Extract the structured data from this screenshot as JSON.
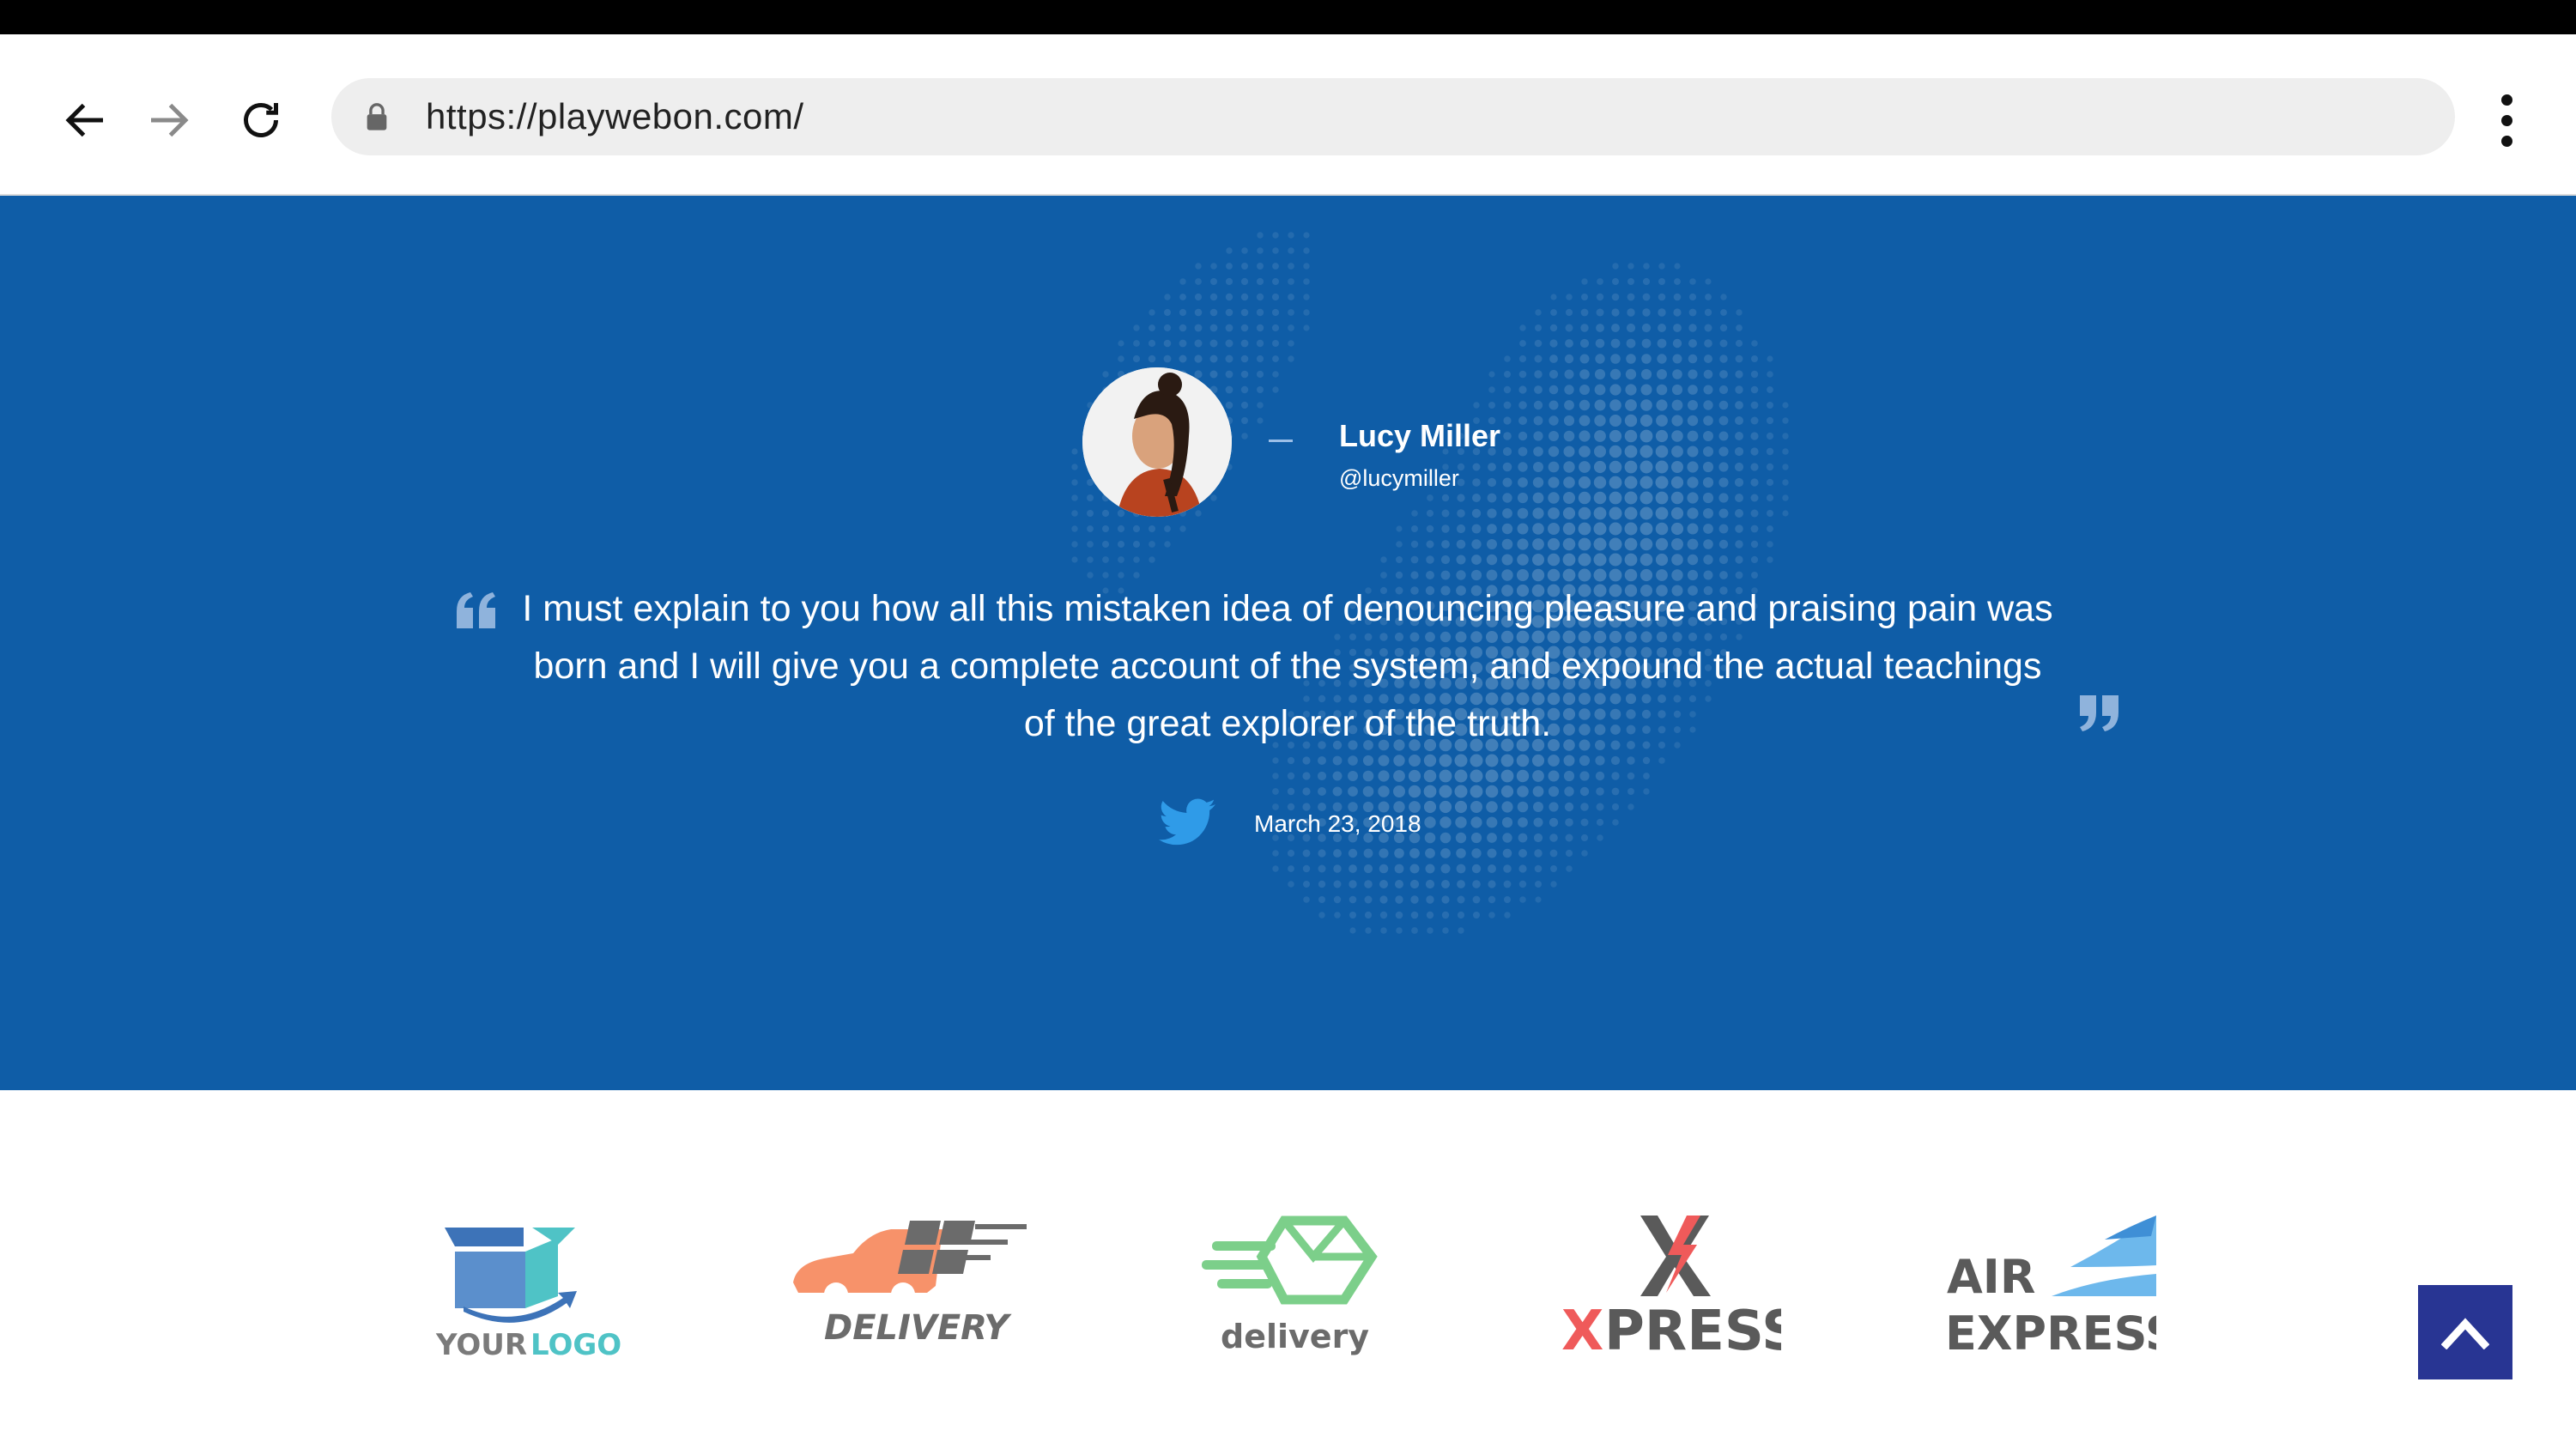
{
  "browser": {
    "url": "https://playwebon.com/",
    "back_icon": "arrow-left-icon",
    "forward_icon": "arrow-right-icon",
    "reload_icon": "reload-icon",
    "lock_icon": "lock-icon",
    "menu_icon": "more-vertical-icon"
  },
  "testimonial": {
    "author_name": "Lucy Miller",
    "author_handle": "@lucymiller",
    "quote": "I must explain to you how all this mistaken idea of denouncing pleasure and praising pain was born and I will give you a complete account of the system, and expound the actual teachings of the great explorer of the truth.",
    "source_icon": "twitter-icon",
    "date": "March 23, 2018"
  },
  "partners": {
    "logos": [
      {
        "line1": "YOUR",
        "line2": "LOGO"
      },
      {
        "line1": "DELIVERY"
      },
      {
        "line1": "delivery"
      },
      {
        "line1": "X",
        "line2": "PRESS"
      },
      {
        "line1": "AIR",
        "line2": "EXPRESS"
      }
    ]
  },
  "colors": {
    "hero_background": "#0f5da7",
    "scroll_top_button": "#283593",
    "twitter": "#1da1f2"
  },
  "scroll_top": {
    "icon": "chevron-up-icon"
  }
}
